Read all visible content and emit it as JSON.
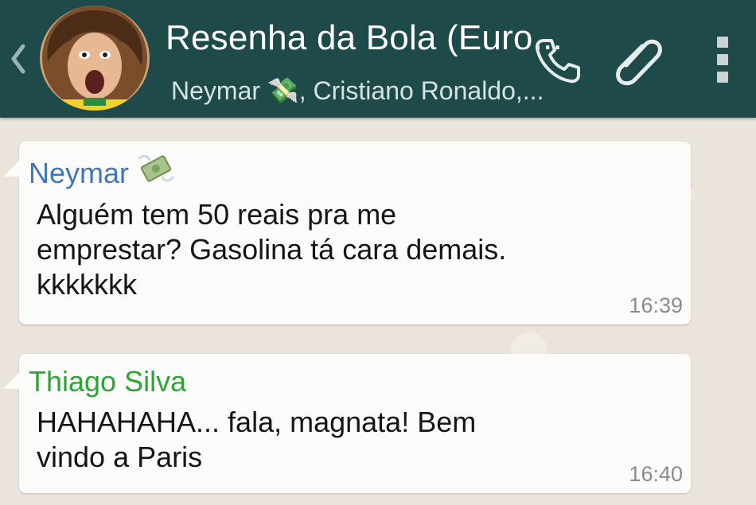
{
  "header": {
    "title": "Resenha da Bola (Euro...",
    "subtitle": "Neymar 💸, Cristiano Ronaldo,...",
    "back_icon": "chevron-left-icon",
    "avatar_icon": "group-avatar",
    "call_icon": "phone-icon",
    "attach_icon": "paperclip-icon",
    "menu_icon": "more-vert-icon"
  },
  "messages": [
    {
      "sender": "Neymar",
      "sender_emoji": "money-with-wings-icon",
      "text_lines": [
        "Alguém tem 50 reais pra me",
        "emprestar? Gasolina tá cara demais.",
        "kkkkkkk"
      ],
      "time": "16:39",
      "sender_color": "#3f79b5"
    },
    {
      "sender": "Thiago Silva",
      "text_lines": [
        "HAHAHAHA... fala, magnata! Bem",
        "vindo a Paris"
      ],
      "time": "16:40",
      "sender_color": "#2aa536"
    }
  ],
  "colors": {
    "header_bg": "#1f4a4a",
    "chat_bg": "#ece5dd",
    "bubble_bg": "#fbfcf9"
  }
}
